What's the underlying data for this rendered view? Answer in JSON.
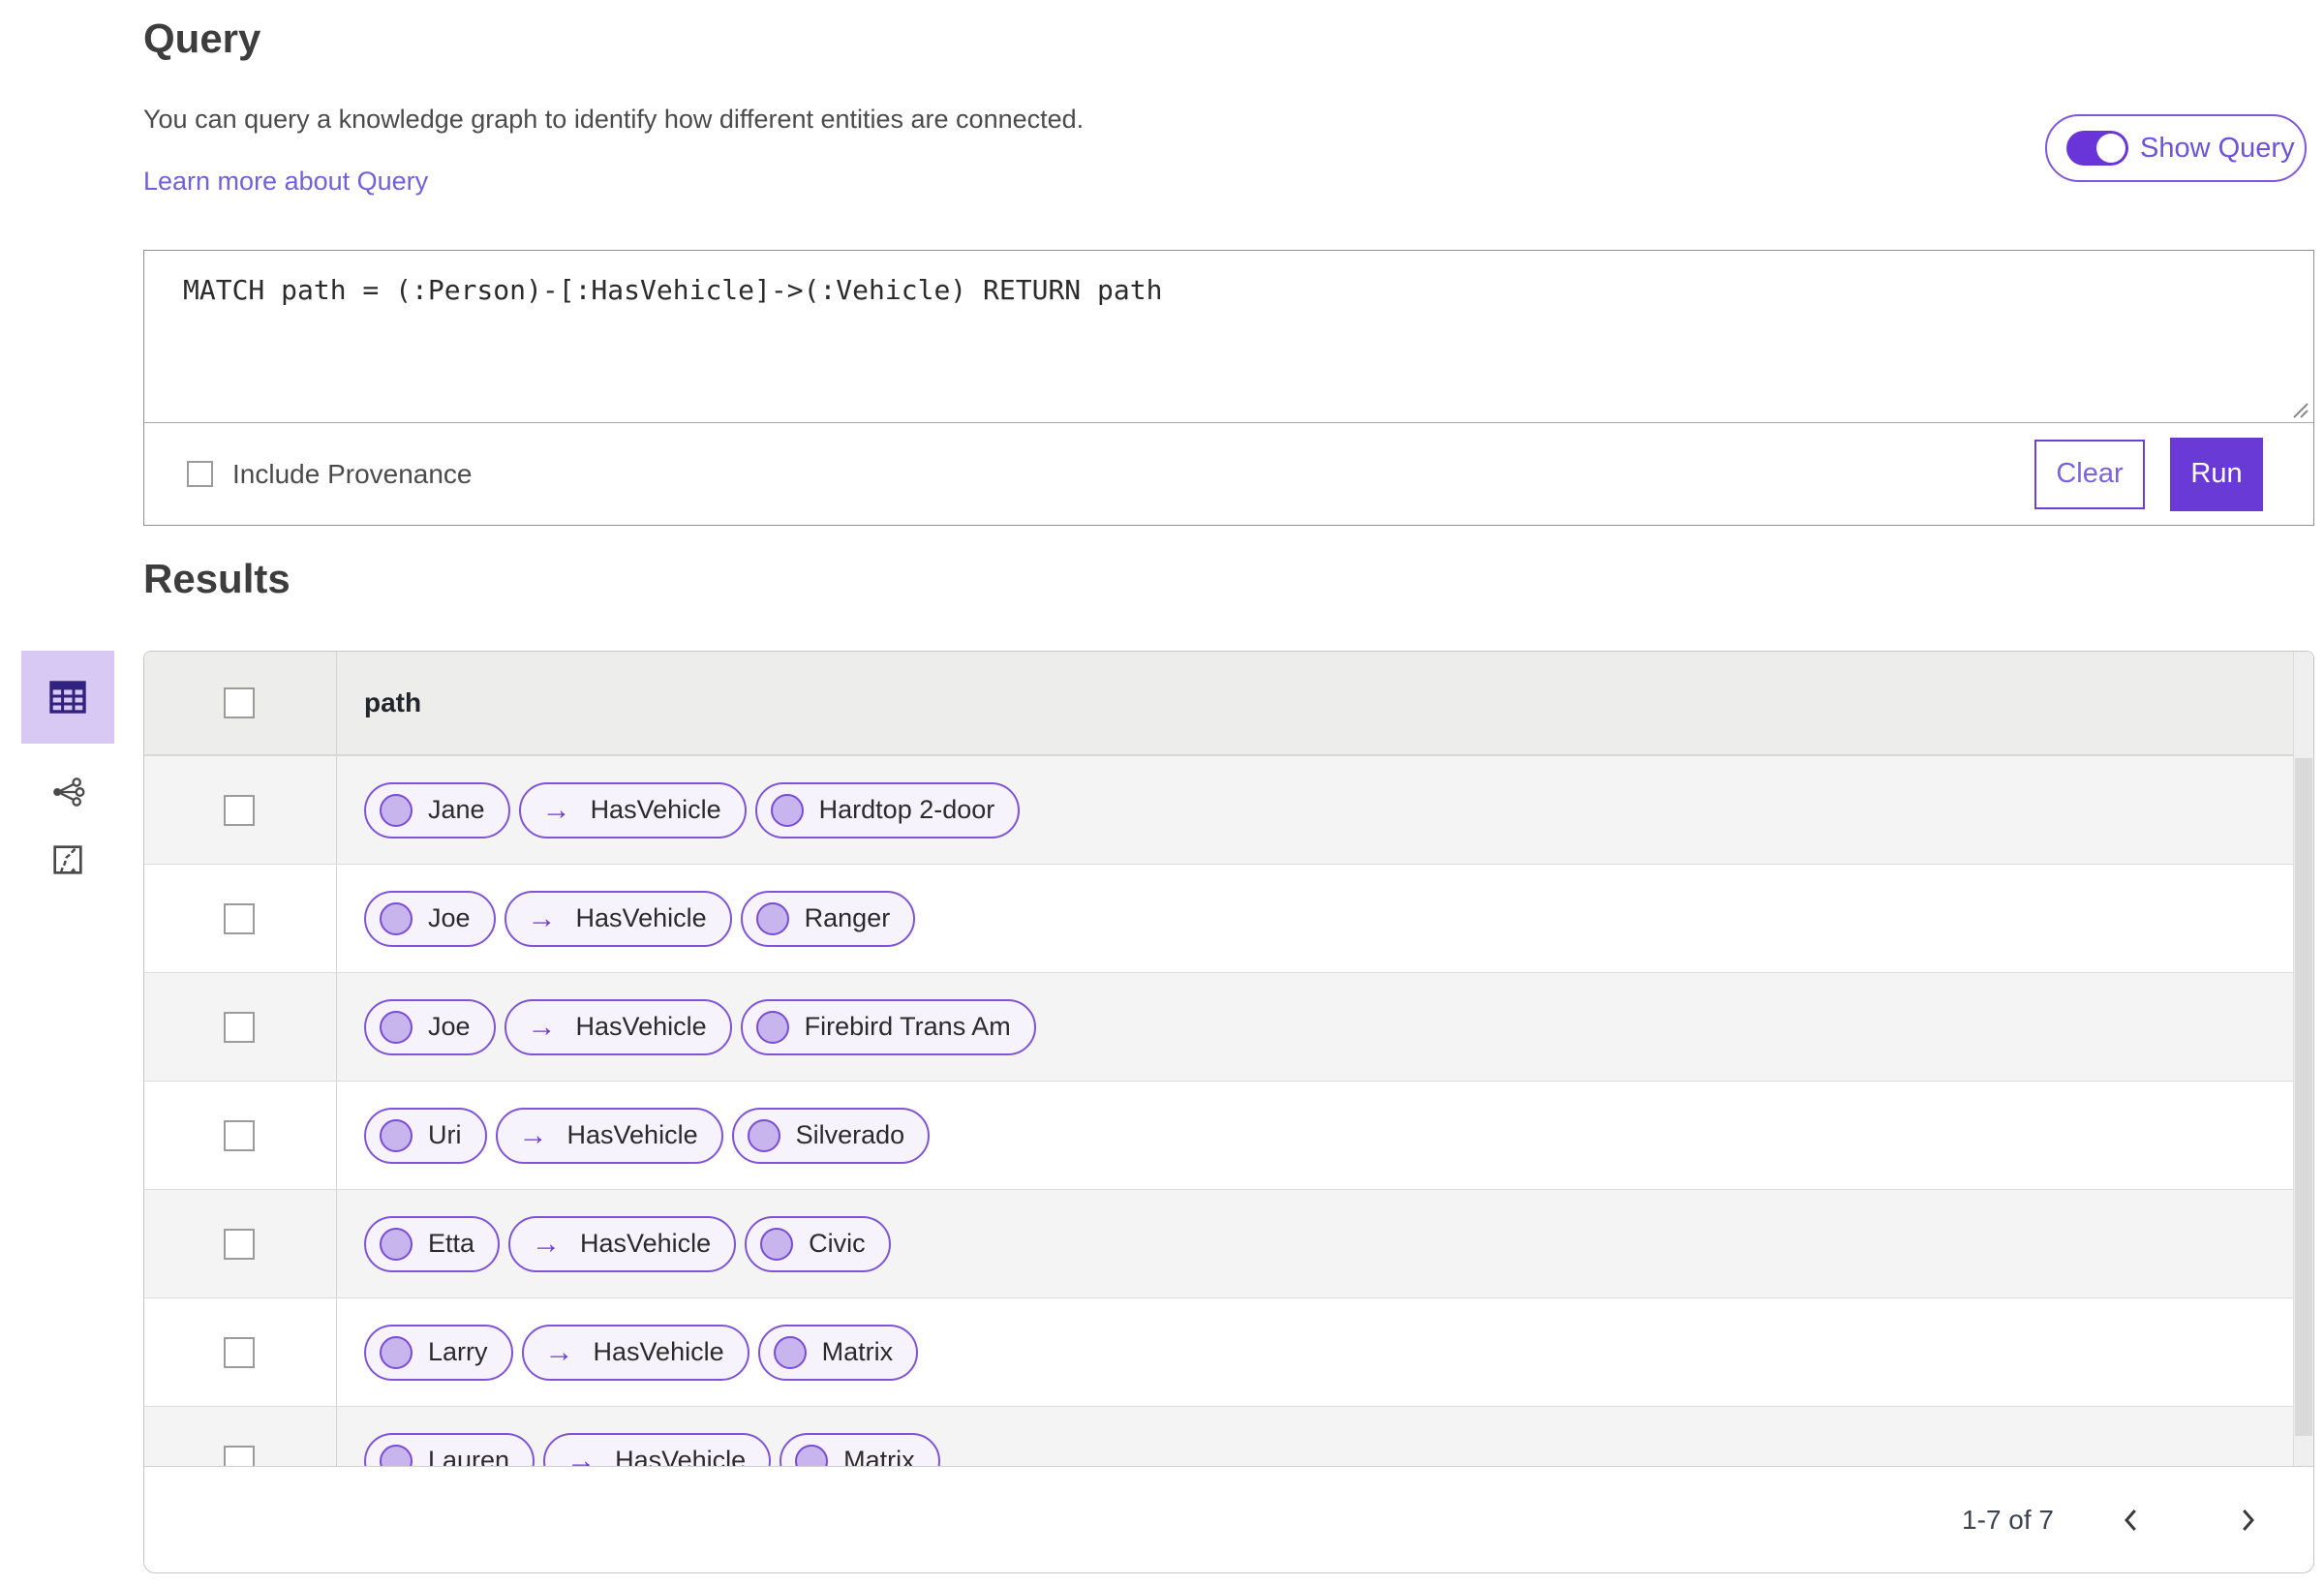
{
  "colors": {
    "accent": "#6a3ad6",
    "accent_selected_bg": "#d7c8f4",
    "pill_border": "#7e54d8",
    "pill_background": "#f6f3fd",
    "node_fill": "#c9b5ee",
    "link_text": "#7161d8"
  },
  "query_section": {
    "title": "Query",
    "description": "You can query a knowledge graph to identify how different entities are connected.",
    "learn_more_link": "Learn more about Query",
    "show_query_toggle": {
      "label": "Show Query",
      "state": "on"
    },
    "editor": {
      "value": "MATCH path = (:Person)-[:HasVehicle]->(:Vehicle) RETURN path"
    },
    "include_provenance": {
      "label": "Include Provenance",
      "checked": false
    },
    "buttons": {
      "clear": "Clear",
      "run": "Run"
    }
  },
  "results_section": {
    "title": "Results",
    "view_switcher": [
      {
        "name": "table-view",
        "selected": true
      },
      {
        "name": "link-chart-view",
        "selected": false
      },
      {
        "name": "map-view",
        "selected": false
      }
    ],
    "table": {
      "columns": [
        "path"
      ],
      "relation_arrow": "→",
      "rows": [
        {
          "path": {
            "source": "Jane",
            "relation": "HasVehicle",
            "target": "Hardtop 2-door"
          }
        },
        {
          "path": {
            "source": "Joe",
            "relation": "HasVehicle",
            "target": "Ranger"
          }
        },
        {
          "path": {
            "source": "Joe",
            "relation": "HasVehicle",
            "target": "Firebird Trans Am"
          }
        },
        {
          "path": {
            "source": "Uri",
            "relation": "HasVehicle",
            "target": "Silverado"
          }
        },
        {
          "path": {
            "source": "Etta",
            "relation": "HasVehicle",
            "target": "Civic"
          }
        },
        {
          "path": {
            "source": "Larry",
            "relation": "HasVehicle",
            "target": "Matrix"
          }
        },
        {
          "path": {
            "source": "Lauren",
            "relation": "HasVehicle",
            "target": "Matrix"
          }
        }
      ]
    },
    "pagination": {
      "range_label": "1-7 of 7"
    }
  }
}
